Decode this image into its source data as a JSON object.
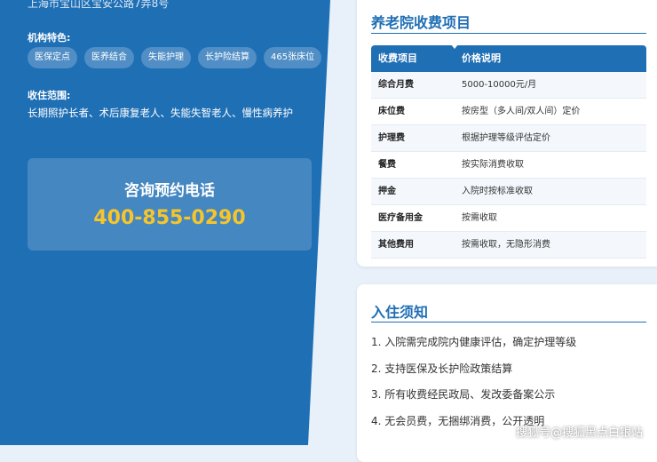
{
  "profile": {
    "address": "上海市宝山区宝安公路7弄8号",
    "features_label": "机构特色:",
    "features": [
      "医保定点",
      "医养结合",
      "失能护理",
      "长护险结算",
      "465张床位"
    ],
    "range_label": "收住范围:",
    "range_text": "长期照护长者、术后康复老人、失能失智老人、慢性病养护"
  },
  "contact": {
    "title": "咨询预约电话",
    "phone": "400-855-0290"
  },
  "fees": {
    "title": "养老院收费项目",
    "headers": [
      "收费项目",
      "价格说明"
    ],
    "rows": [
      [
        "综合月费",
        "5000-10000元/月"
      ],
      [
        "床位费",
        "按房型（多人间/双人间）定价"
      ],
      [
        "护理费",
        "根据护理等级评估定价"
      ],
      [
        "餐费",
        "按实际消费收取"
      ],
      [
        "押金",
        "入院时按标准收取"
      ],
      [
        "医疗备用金",
        "按需收取"
      ],
      [
        "其他费用",
        "按需收取，无隐形消费"
      ]
    ]
  },
  "notes": {
    "title": "入住须知",
    "items": [
      "1. 入院需完成院内健康评估，确定护理等级",
      "2. 支持医保及长护险政策结算",
      "3. 所有收费经民政局、发改委备案公示",
      "4. 无会员费，无捆绑消费，公开透明"
    ]
  },
  "watermark": "搜狐号@搜狐黑点白银站",
  "colors": {
    "brand_blue": "#1f6fb5",
    "phone_yellow": "#f7c52b",
    "page_bg": "#e8f1fa"
  }
}
